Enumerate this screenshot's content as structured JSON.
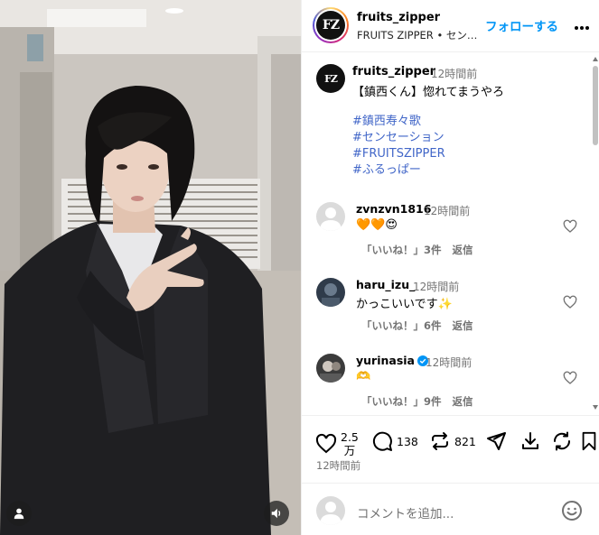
{
  "post": {
    "username": "fruits_zipper",
    "logo_text": "FZ",
    "subline": "FRUITS ZIPPER • センセーション",
    "follow_label": "フォローする",
    "caption": {
      "username": "fruits_zipper",
      "time": "12時間前",
      "text": "【鎮西くん】惚れてまうやろ",
      "hashtags": [
        "#鎮西寿々歌",
        "#センセーション",
        "#FRUITSZIPPER",
        "#ふるっぱー"
      ]
    }
  },
  "comments": [
    {
      "username": "zvnzvn1816",
      "time": "12時間前",
      "text": "🧡🧡😍",
      "likes": "「いいね！」3件",
      "reply": "返信",
      "verified": false
    },
    {
      "username": "haru_izu_",
      "time": "12時間前",
      "text": "かっこいいです✨",
      "likes": "「いいね！」6件",
      "reply": "返信",
      "verified": false
    },
    {
      "username": "yurinasia",
      "time": "12時間前",
      "text": "🫶",
      "likes": "「いいね！」9件",
      "reply": "返信",
      "verified": true
    }
  ],
  "actions": {
    "likes_line1": "2.5",
    "likes_line2": "万",
    "comments_count": "138",
    "reposts_count": "821",
    "post_time": "12時間前"
  },
  "add_comment": {
    "placeholder": "コメントを追加..."
  },
  "colors": {
    "follow": "#0095f6",
    "hashtag": "#4166c8",
    "muted": "#737373",
    "verified": "#0095f6"
  }
}
